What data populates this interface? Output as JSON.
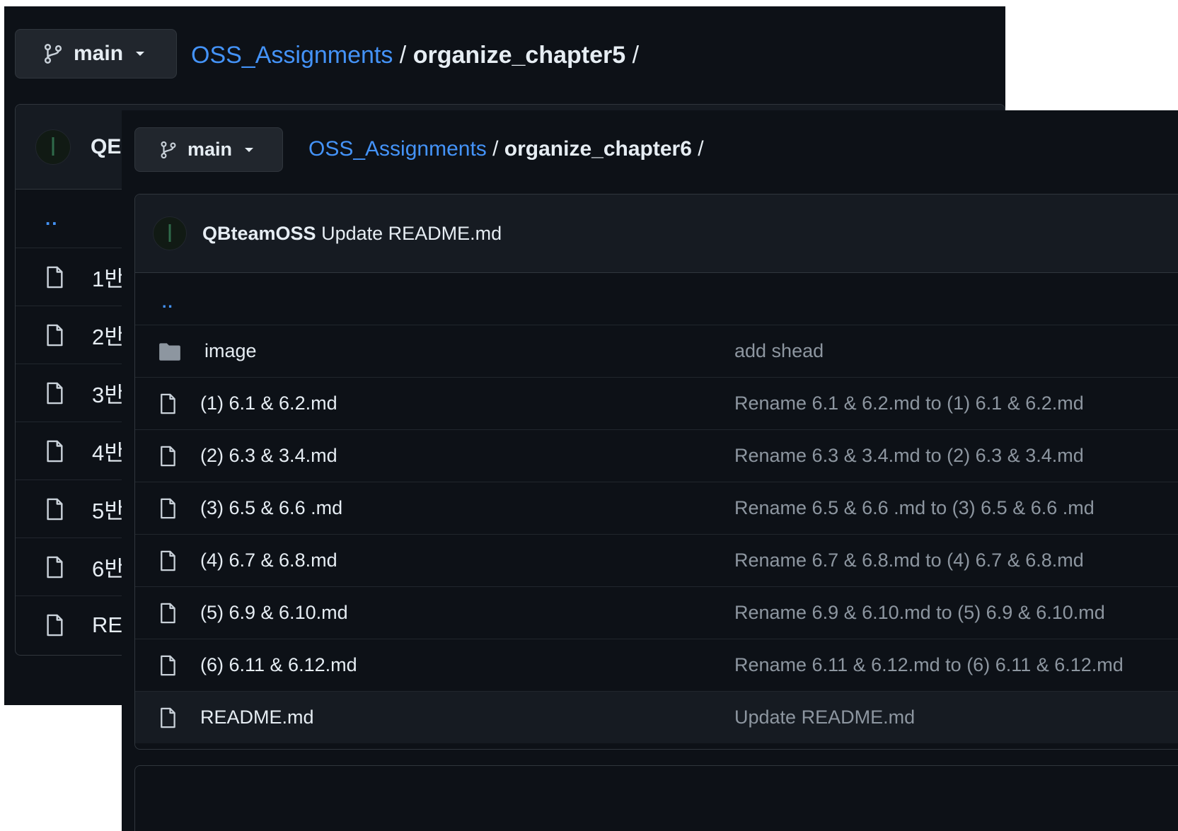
{
  "back_window": {
    "branch": "main",
    "breadcrumb": {
      "repo": "OSS_Assignments",
      "sep1": " / ",
      "folder": "organize_chapter5",
      "sep2": " /"
    },
    "commit_author_partial": "QE",
    "updir": "..",
    "files": [
      {
        "name": "1반",
        "icon": "file-icon"
      },
      {
        "name": "2반",
        "icon": "file-icon"
      },
      {
        "name": "3반",
        "icon": "file-icon"
      },
      {
        "name": "4반",
        "icon": "file-icon"
      },
      {
        "name": "5반",
        "icon": "file-icon"
      },
      {
        "name": "6반",
        "icon": "file-icon"
      },
      {
        "name": "RE",
        "icon": "file-icon"
      }
    ]
  },
  "front_window": {
    "branch": "main",
    "breadcrumb": {
      "repo": "OSS_Assignments",
      "sep1": " / ",
      "folder": "organize_chapter6",
      "sep2": " /"
    },
    "commit": {
      "author": "QBteamOSS",
      "message": "Update README.md"
    },
    "updir": "..",
    "files": [
      {
        "name": "image",
        "icon": "folder-icon",
        "message": "add shead"
      },
      {
        "name": "(1) 6.1 & 6.2.md",
        "icon": "file-icon",
        "message": "Rename 6.1 & 6.2.md to (1) 6.1 & 6.2.md"
      },
      {
        "name": "(2) 6.3 & 3.4.md",
        "icon": "file-icon",
        "message": "Rename 6.3 & 3.4.md to (2) 6.3 & 3.4.md"
      },
      {
        "name": "(3) 6.5 & 6.6 .md",
        "icon": "file-icon",
        "message": "Rename 6.5 & 6.6 .md to (3) 6.5 & 6.6 .md"
      },
      {
        "name": "(4) 6.7 & 6.8.md",
        "icon": "file-icon",
        "message": "Rename 6.7 & 6.8.md to (4) 6.7 & 6.8.md"
      },
      {
        "name": "(5) 6.9 & 6.10.md",
        "icon": "file-icon",
        "message": "Rename 6.9 & 6.10.md to (5) 6.9 & 6.10.md"
      },
      {
        "name": "(6) 6.11 & 6.12.md",
        "icon": "file-icon",
        "message": "Rename 6.11 & 6.12.md to (6) 6.11 & 6.12.md"
      },
      {
        "name": "README.md",
        "icon": "file-icon",
        "message": "Update README.md"
      }
    ]
  },
  "colors": {
    "background": "#0d1117",
    "link": "#4493f8",
    "text": "#e6edf3",
    "muted": "#8d96a0",
    "border": "#30363d"
  }
}
